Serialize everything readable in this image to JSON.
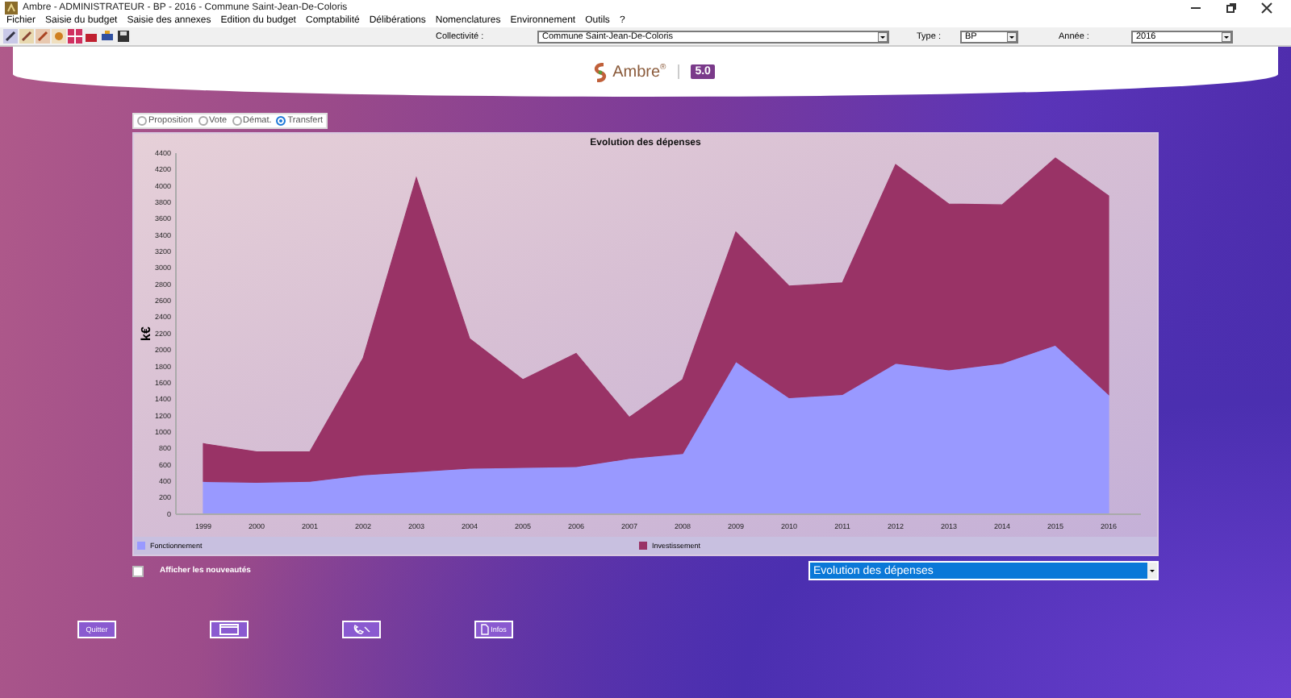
{
  "window": {
    "title": "Ambre - ADMINISTRATEUR - BP - 2016 - Commune Saint-Jean-De-Coloris"
  },
  "menu": [
    "Fichier",
    "Saisie du budget",
    "Saisie des annexes",
    "Edition du budget",
    "Comptabilité",
    "Délibérations",
    "Nomenclatures",
    "Environnement",
    "Outils",
    "?"
  ],
  "toolbar": {
    "fields": [
      {
        "label": "Collectivité :",
        "value": "Commune Saint-Jean-De-Coloris"
      },
      {
        "label": "Type :",
        "value": "BP"
      },
      {
        "label": "Année :",
        "value": "2016"
      }
    ]
  },
  "logo": {
    "name": "Ambre$^{®}$",
    "version": "5.0"
  },
  "modes": [
    {
      "label": "Proposition",
      "selected": false
    },
    {
      "label": "Vote",
      "selected": false
    },
    {
      "label": "Démat.",
      "selected": false
    },
    {
      "label": "Transfert",
      "selected": true
    }
  ],
  "chart": {
    "chart_data": {
      "type": "area",
      "title": "Evolution des dépenses",
      "ylabel": "k€",
      "stacked": true,
      "categories": [
        "1999",
        "2000",
        "2001",
        "2002",
        "2003",
        "2004",
        "2005",
        "2006",
        "2007",
        "2008",
        "2009",
        "2010",
        "2011",
        "2012",
        "2013",
        "2014",
        "2015",
        "2016"
      ],
      "ylim": [
        0,
        4400
      ],
      "yticks": [
        0,
        200,
        400,
        600,
        800,
        1000,
        1200,
        1400,
        1600,
        1800,
        2000,
        2200,
        2400,
        2600,
        2800,
        3000,
        3200,
        3400,
        3600,
        3800,
        4000,
        4200,
        4400
      ],
      "series": [
        {
          "name": "Fonctionnement",
          "color": "#9999ff",
          "values": [
            400,
            390,
            400,
            480,
            520,
            560,
            570,
            580,
            680,
            740,
            1860,
            1420,
            1460,
            1840,
            1760,
            1840,
            2060,
            1460
          ]
        },
        {
          "name": "Investissement",
          "color": "#993366",
          "values": [
            460,
            370,
            360,
            1420,
            3580,
            1580,
            1070,
            1380,
            500,
            900,
            1580,
            1360,
            1360,
            2420,
            2020,
            1930,
            2280,
            2420
          ]
        }
      ]
    }
  },
  "show_news": {
    "label": "Afficher les nouveautés",
    "checked": false
  },
  "view_select": {
    "value": "Evolution des dépenses"
  },
  "buttons": [
    {
      "kind": "text",
      "label": "Quitter"
    },
    {
      "kind": "web"
    },
    {
      "kind": "phone"
    },
    {
      "kind": "doc",
      "label": "Infos"
    }
  ]
}
